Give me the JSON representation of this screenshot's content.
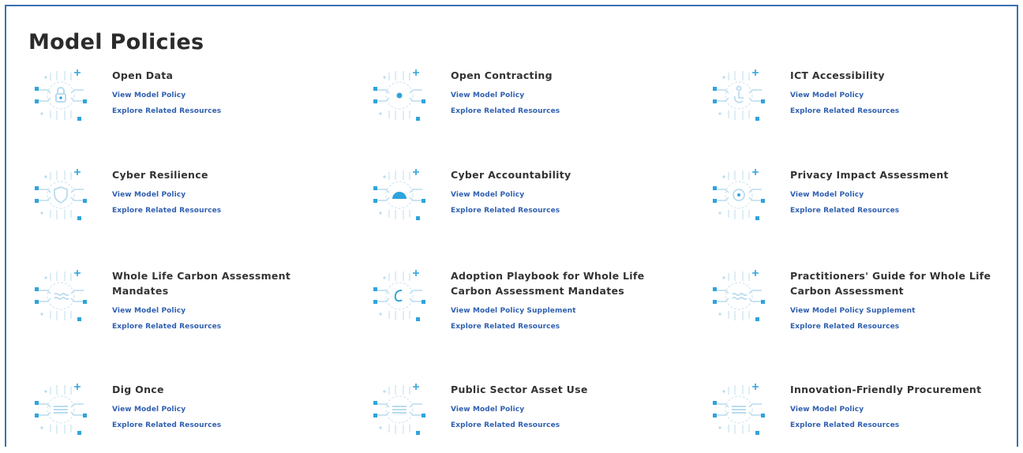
{
  "page": {
    "title": "Model Policies"
  },
  "colors": {
    "accent": "#2fa4dc",
    "link": "#2f5fb0",
    "frame": "#3d6fb3",
    "text": "#333333"
  },
  "policies": [
    {
      "title": "Open Data",
      "icon": "lock-icon",
      "link1": "View Model Policy",
      "link2": "Explore Related Resources"
    },
    {
      "title": "Open Contracting",
      "icon": "dot-icon",
      "link1": "View Model Policy",
      "link2": "Explore Related Resources"
    },
    {
      "title": "ICT Accessibility",
      "icon": "accessibility-icon",
      "link1": "View Model Policy",
      "link2": "Explore Related Resources"
    },
    {
      "title": "Cyber Resilience",
      "icon": "shield-icon",
      "link1": "View Model Policy",
      "link2": "Explore Related Resources"
    },
    {
      "title": "Cyber Accountability",
      "icon": "dome-icon",
      "link1": "View Model Policy",
      "link2": "Explore Related Resources"
    },
    {
      "title": "Privacy Impact Assessment",
      "icon": "target-icon",
      "link1": "View Model Policy",
      "link2": "Explore Related Resources"
    },
    {
      "title": "Whole Life Carbon Assessment Mandates",
      "icon": "cycle-icon",
      "link1": "View Model Policy",
      "link2": "Explore Related Resources"
    },
    {
      "title": "Adoption Playbook for Whole Life Carbon Assessment Mandates",
      "icon": "leaf-icon",
      "link1": "View Model Policy Supplement",
      "link2": "Explore Related Resources"
    },
    {
      "title": "Practitioners' Guide for Whole Life Carbon Assessment",
      "icon": "cycle-icon",
      "link1": "View Model Policy Supplement",
      "link2": "Explore Related Resources"
    },
    {
      "title": "Dig Once",
      "icon": "layers-icon",
      "link1": "View Model Policy",
      "link2": "Explore Related Resources"
    },
    {
      "title": "Public Sector Asset Use",
      "icon": "layers-icon",
      "link1": "View Model Policy",
      "link2": "Explore Related Resources"
    },
    {
      "title": "Innovation-Friendly Procurement",
      "icon": "layers-icon",
      "link1": "View Model Policy",
      "link2": "Explore Related Resources"
    }
  ]
}
